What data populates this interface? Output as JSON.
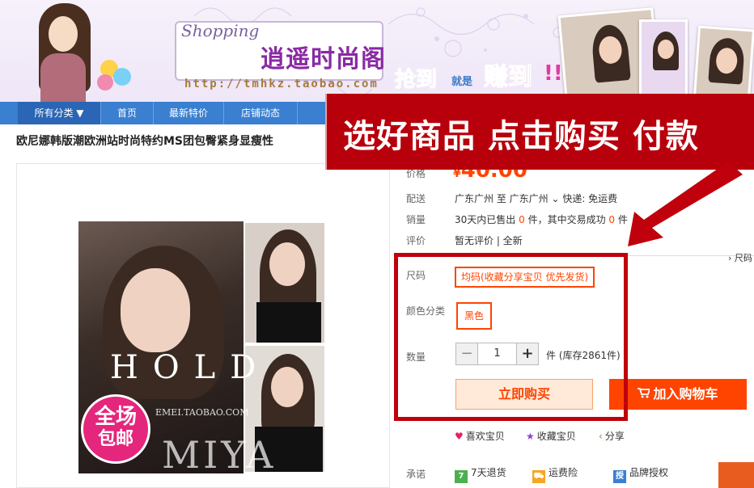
{
  "banner": {
    "shopping": "Shopping",
    "store_name": "逍遥时尚阁",
    "url": "http://tmhkz.taobao.com",
    "slogan_1": "抢到",
    "slogan_jiu": "就是",
    "slogan_2": "赚到",
    "slogan_exclaim": "!!"
  },
  "nav": {
    "items": [
      {
        "label": "所有分类 ▼"
      },
      {
        "label": "首页"
      },
      {
        "label": "最新特价"
      },
      {
        "label": "店铺动态"
      }
    ]
  },
  "overlay": {
    "text": "选好商品  点击购买  付款"
  },
  "product": {
    "title": "欧尼娜韩版潮欧洲站时尚特约MS团包臀紧身显瘦性",
    "image_text": {
      "hold": "HOLD",
      "watermark": "EMEI.TAOBAO.COM",
      "miya": "MIYA"
    },
    "badge": {
      "line1": "全场",
      "line2": "包邮"
    }
  },
  "info": {
    "price_label": "价格",
    "price_currency": "¥",
    "price_value": "40.00",
    "shipping_label": "配送",
    "shipping_text": "广东广州 至 广东广州 ⌄ 快递: 免运费",
    "sales_label": "销量",
    "sales_prefix": "30天内已售出",
    "sales_count": "0",
    "sales_mid": "件，其中交易成功",
    "sales_success": "0",
    "sales_suffix": "件",
    "review_label": "评价",
    "review_text": "暂无评价 | 全新",
    "more_link": "› 尺码"
  },
  "sku": {
    "size_label": "尺码",
    "size_value": "均码(收藏分享宝贝 优先发货)",
    "color_label": "颜色分类",
    "color_value": "黑色",
    "qty_label": "数量",
    "qty_minus": "−",
    "qty_value": "1",
    "qty_plus": "+",
    "stock_text": "件 (库存2861件)",
    "buy_label": "立即购买",
    "cart_label": "加入购物车"
  },
  "social": {
    "like": "喜欢宝贝",
    "fav": "收藏宝贝",
    "share": "分享"
  },
  "promise": {
    "label": "承诺",
    "return": "7天退货",
    "return_icon": "7",
    "freight": "运费险",
    "brand": "品牌授权",
    "brand_icon": "授"
  },
  "colors": {
    "accent": "#ff4400",
    "nav_blue": "#3a7fd0",
    "overlay_red": "#b8000c",
    "frame_red": "#c0000c"
  }
}
